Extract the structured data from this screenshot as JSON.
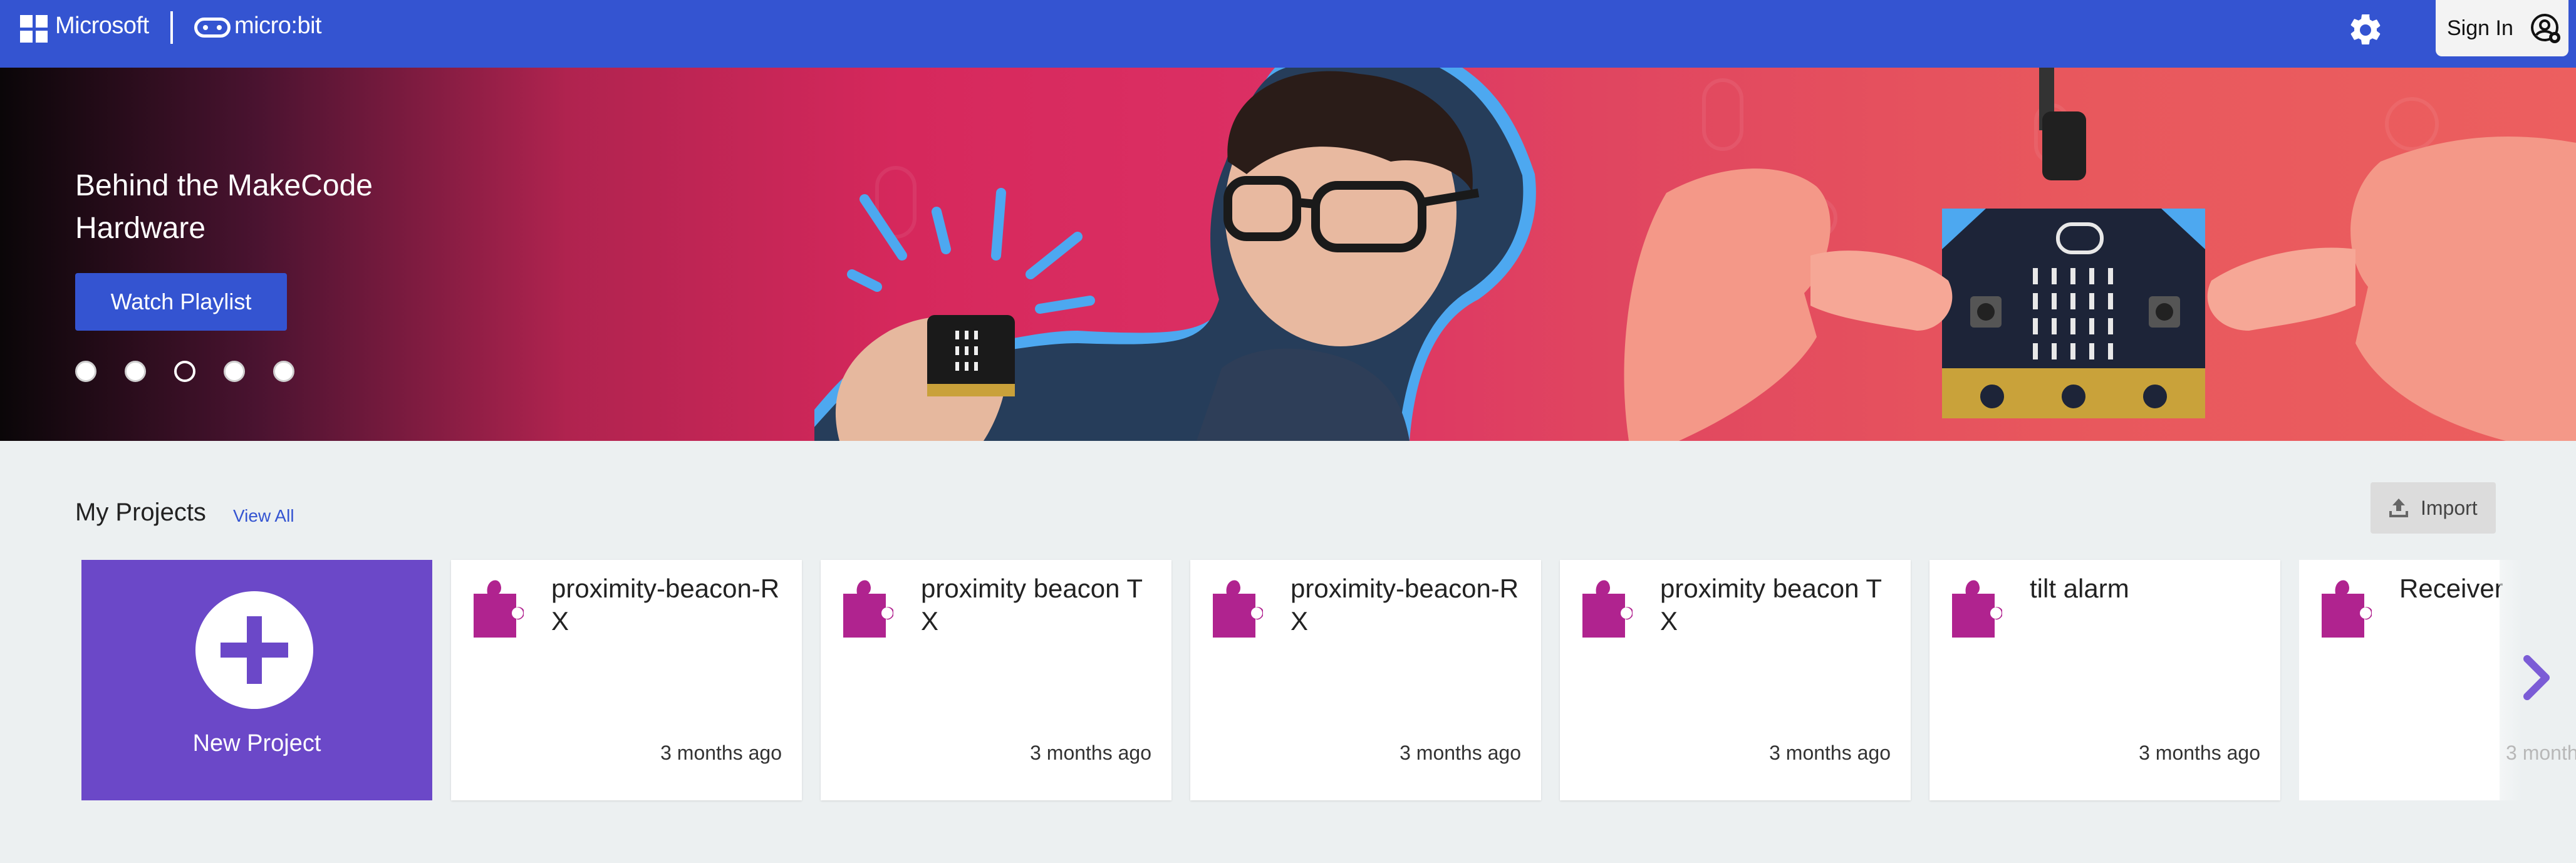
{
  "header": {
    "microsoft_label": "Microsoft",
    "microbit_label": "micro:bit",
    "settings_icon": "gear-icon",
    "signin_label": "Sign In",
    "signin_icon": "user-circle-icon",
    "bar_color": "#3454d1"
  },
  "hero": {
    "title": "Behind the MakeCode Hardware",
    "button_label": "Watch Playlist",
    "slide_count": 5,
    "active_slide": 3
  },
  "projects": {
    "heading": "My Projects",
    "view_all_label": "View All",
    "import_label": "Import",
    "new_project_label": "New Project",
    "items": [
      {
        "name": "proximity-beacon-RX",
        "time": "3 months ago"
      },
      {
        "name": "proximity beacon TX",
        "time": "3 months ago"
      },
      {
        "name": "proximity-beacon-RX",
        "time": "3 months ago"
      },
      {
        "name": "proximity beacon TX",
        "time": "3 months ago"
      },
      {
        "name": "tilt alarm",
        "time": "3 months ago"
      },
      {
        "name": "Receiver",
        "time": "3 month"
      }
    ],
    "card_icon": "puzzle-icon",
    "accent_color": "#b0238f",
    "new_card_color": "#6b48c8"
  }
}
